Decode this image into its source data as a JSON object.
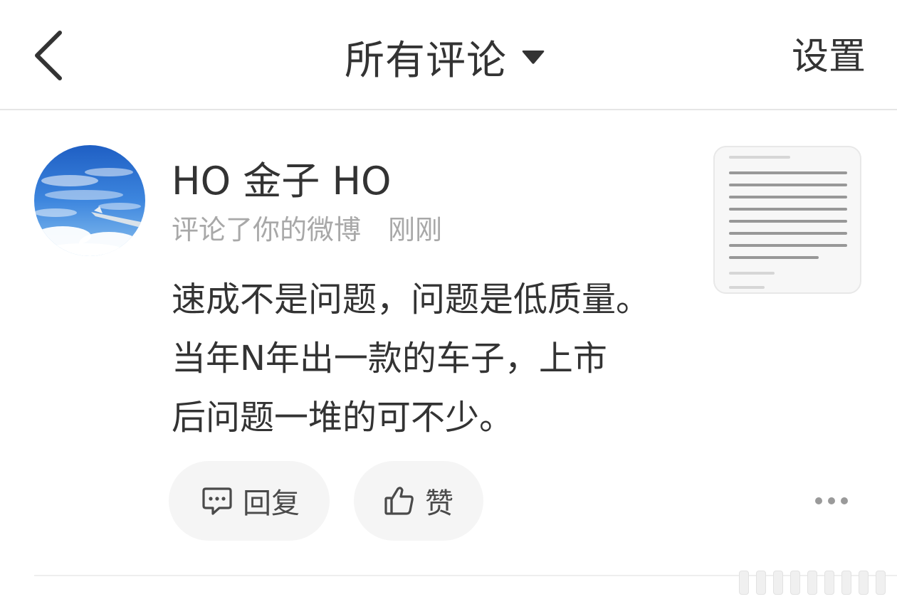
{
  "header": {
    "title": "所有评论",
    "settings_label": "设置",
    "back_icon": "chevron-left-icon",
    "dropdown_icon": "caret-down-icon"
  },
  "notification": {
    "username": "HO 金子 HO",
    "action_text": "评论了你的微博",
    "time": "刚刚",
    "comment_lines": [
      "速成不是问题，问题是低质量。",
      "当年N年出一款的车子，上市",
      "后问题一堆的可不少。"
    ],
    "thumbnail_icon": "weibo-post-thumbnail"
  },
  "actions": {
    "reply_label": "回复",
    "like_label": "赞",
    "reply_icon": "comment-bubble-icon",
    "like_icon": "thumbs-up-icon",
    "more_icon": "more-dots-icon"
  },
  "colors": {
    "text_primary": "#333333",
    "text_secondary": "#a8a8a8",
    "button_bg": "#f5f5f5",
    "divider": "#e6e6e6"
  }
}
